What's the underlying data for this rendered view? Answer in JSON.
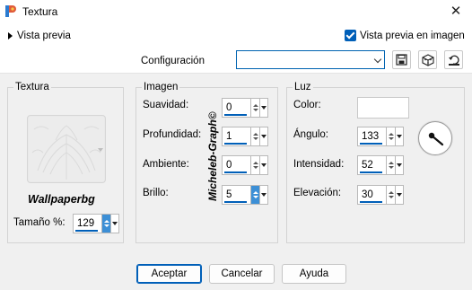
{
  "window": {
    "title": "Textura",
    "close_glyph": "✕"
  },
  "preview": {
    "toggle_label": "Vista previa",
    "checkbox_label": "Vista previa en imagen",
    "checked": true
  },
  "config": {
    "label": "Configuración",
    "value": ""
  },
  "texture_group": {
    "title": "Textura",
    "texture_name": "Wallpaperbg",
    "size_label": "Tamaño %:",
    "size_value": "129"
  },
  "image_group": {
    "title": "Imagen",
    "smoothness_label": "Suavidad:",
    "smoothness_value": "0",
    "depth_label": "Profundidad:",
    "depth_value": "1",
    "ambient_label": "Ambiente:",
    "ambient_value": "0",
    "brightness_label": "Brillo:",
    "brightness_value": "5"
  },
  "light_group": {
    "title": "Luz",
    "color_label": "Color:",
    "color_value": "#ffffff",
    "angle_label": "Ángulo:",
    "angle_value": "133",
    "intensity_label": "Intensidad:",
    "intensity_value": "52",
    "elevation_label": "Elevación:",
    "elevation_value": "30"
  },
  "watermark": "Micheleb-Graph©",
  "buttons": {
    "ok": "Aceptar",
    "cancel": "Cancelar",
    "help": "Ayuda"
  },
  "colors": {
    "accent": "#005fb8",
    "spin_active": "#3c8fd6"
  },
  "icons": [
    "app-icon",
    "close-icon",
    "expand-arrow-icon",
    "check-icon",
    "chevron-down-icon",
    "save-icon",
    "delete-icon",
    "reset-icon"
  ]
}
